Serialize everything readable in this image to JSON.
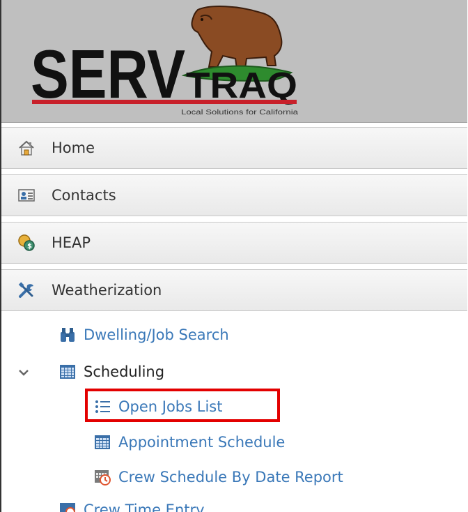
{
  "logo": {
    "serv": "SERV",
    "traq": "TRAQ",
    "tagline": "Local Solutions for California"
  },
  "nav": {
    "home": "Home",
    "contacts": "Contacts",
    "heap": "HEAP",
    "weatherization": "Weatherization"
  },
  "submenu": {
    "dwelling_search": "Dwelling/Job Search",
    "scheduling": "Scheduling",
    "open_jobs_list": "Open Jobs List",
    "appointment_schedule": "Appointment Schedule",
    "crew_schedule_report": "Crew Schedule By Date Report",
    "crew_time_entry": "Crew Time Entry"
  },
  "icons": {
    "home": "home-icon",
    "contacts": "contact-card-icon",
    "heap": "coins-icon",
    "weatherization": "tools-icon",
    "dwelling_search": "binoculars-icon",
    "scheduling": "calendar-grid-icon",
    "open_jobs_list": "list-icon",
    "appointment_schedule": "calendar-grid-icon",
    "crew_schedule_report": "calendar-clock-icon",
    "expand": "chevron-down-icon"
  },
  "colors": {
    "link": "#3a78b8",
    "highlight": "#e30000",
    "header_bg": "#bfbfbf"
  }
}
